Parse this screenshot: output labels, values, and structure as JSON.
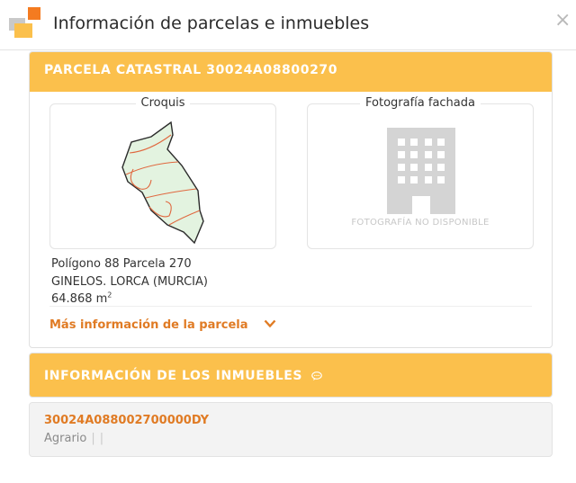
{
  "header": {
    "title": "Información de parcelas e inmuebles",
    "close_glyph": "×"
  },
  "parcel": {
    "title": "PARCELA CATASTRAL 30024A08800270",
    "sketch_label": "Croquis",
    "photo_label": "Fotografía fachada",
    "photo_unavailable": "FOTOGRAFÍA NO DISPONIBLE",
    "location_line": "Polígono 88 Parcela 270",
    "municipality_line": "GINELOS. LORCA (MURCIA)",
    "area_value": "64.868 m",
    "area_unit_exp": "2",
    "more_info_link": "Más información de la parcela"
  },
  "properties": {
    "title": "INFORMACIÓN DE LOS INMUEBLES",
    "items": [
      {
        "reference": "30024A088002700000DY",
        "usage": "Agrario"
      }
    ]
  },
  "colors": {
    "accent": "#fbc04c",
    "link": "#e07b24",
    "logo_orange": "#f47b20",
    "logo_yellow": "#fbc04c"
  },
  "icons": [
    "cadastre-logo-icon",
    "close-icon",
    "parcel-sketch-icon",
    "building-placeholder-icon",
    "chevron-down-icon",
    "speech-bubble-icon"
  ]
}
